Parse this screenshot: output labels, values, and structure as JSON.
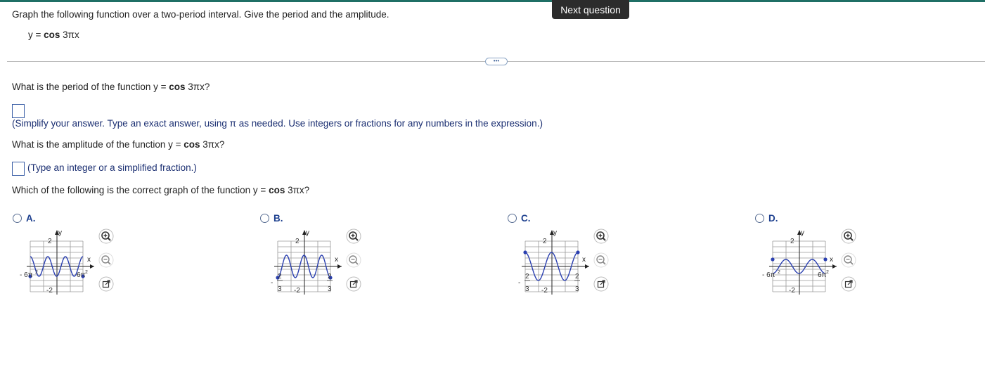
{
  "top": {
    "next_question": "Next question"
  },
  "question": {
    "instruction": "Graph the following function over a two-period interval. Give the period and the amplitude.",
    "function_lhs": "y = ",
    "function_cos": "cos",
    "function_arg": " 3πx"
  },
  "parts": {
    "period_q_pre": "What is the period of the function y = ",
    "period_q_cos": "cos",
    "period_q_post": " 3πx?",
    "period_value": "",
    "period_hint": "(Simplify your answer. Type an exact answer, using π as needed. Use integers or fractions for any numbers in the expression.)",
    "amp_q_pre": "What is the amplitude of the function y = ",
    "amp_q_cos": "cos",
    "amp_q_post": " 3πx?",
    "amp_value": "",
    "amp_hint": "(Type an integer or a simplified fraction.)",
    "graph_q_pre": "Which of the following is the correct graph of the function y = ",
    "graph_q_cos": "cos",
    "graph_q_post": " 3πx?"
  },
  "options": [
    {
      "letter": "A.",
      "ymax_label": "2",
      "ymin_label": "-2",
      "x_left": "- 6π",
      "x_left_sup": "2",
      "x_right": "6π",
      "x_right_sup": "2",
      "curve_color": "#2a3fb0"
    },
    {
      "letter": "B.",
      "ymax_label": "2",
      "ymin_label": "-2",
      "x_left_num": "2",
      "x_left_den": "3",
      "x_right_num": "2",
      "x_right_den": "3",
      "curve_color": "#2a3fb0"
    },
    {
      "letter": "C.",
      "ymax_label": "2",
      "ymin_label": "-2",
      "x_left_num": "2",
      "x_left_den": "3",
      "x_right_num": "2",
      "x_right_den": "3",
      "curve_color": "#2a3fb0"
    },
    {
      "letter": "D.",
      "ymax_label": "2",
      "ymin_label": "-2",
      "x_left": "- 6π",
      "x_left_sup": "2",
      "x_right": "6π",
      "x_right_sup": "2",
      "curve_color": "#2a3fb0"
    }
  ],
  "axis": {
    "y_label": "y",
    "x_label": "x"
  },
  "icons": {
    "zoom_in": "zoom-in-icon",
    "zoom_out": "zoom-out-icon",
    "popout": "popout-icon"
  },
  "colors": {
    "accent_bar": "#1f6f65",
    "link_blue": "#1b2f72",
    "curve": "#2a3fb0"
  }
}
